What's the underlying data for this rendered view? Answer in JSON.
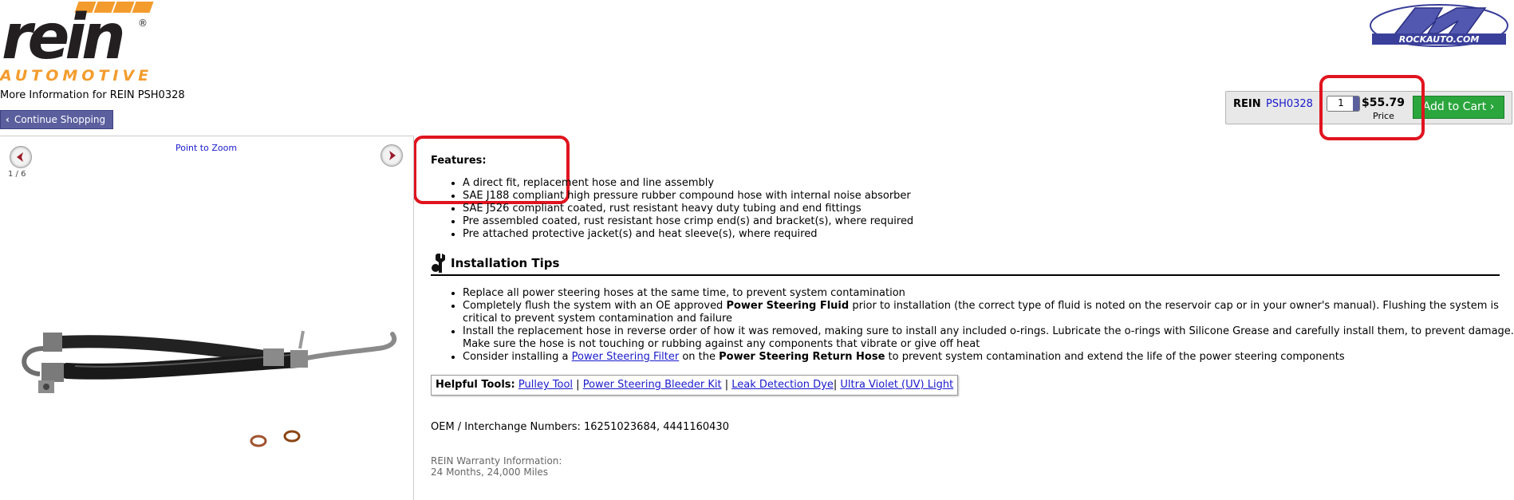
{
  "logo": {
    "wordmark": "rein",
    "registered": "®",
    "tagline": "AUTOMOTIVE"
  },
  "header": {
    "more_info": "More Information for REIN PSH0328",
    "continue_label": "Continue Shopping",
    "site_logo_text": "ROCKAUTO.COM"
  },
  "cart": {
    "brand": "REIN",
    "part_number": "PSH0328",
    "quantity": "1",
    "price": "$55.79",
    "price_label": "Price",
    "add_label": "Add to Cart"
  },
  "gallery": {
    "zoom_label": "Point to Zoom",
    "counter": "1 / 6"
  },
  "features": {
    "title": "Features:",
    "items": [
      "A direct fit, replacement hose and line assembly",
      "SAE J188 compliant high pressure rubber compound hose with internal noise absorber",
      "SAE J526 compliant coated, rust resistant heavy duty tubing and end fittings",
      "Pre assembled coated, rust resistant hose crimp end(s) and bracket(s), where required",
      "Pre attached protective jacket(s) and heat sleeve(s), where required"
    ]
  },
  "install": {
    "title": "Installation Tips",
    "tip1": "Replace all power steering hoses at the same time, to prevent system contamination",
    "tip2_a": "Completely flush the system with an OE approved ",
    "tip2_b": "Power Steering Fluid",
    "tip2_c": " prior to installation (the correct type of fluid is noted on the reservoir cap or in your owner's manual). Flushing the system is critical to prevent system contamination and failure",
    "tip3": "Install the replacement hose in reverse order of how it was removed, making sure to install any included o-rings. Lubricate the o-rings with Silicone Grease and carefully install them, to prevent damage. Make sure the hose is not touching or rubbing against any components that vibrate or give off heat",
    "tip4_a": "Consider installing a ",
    "tip4_link": "Power Steering Filter",
    "tip4_b": " on the ",
    "tip4_bold": "Power Steering Return Hose",
    "tip4_c": " to prevent system contamination and extend the life of the power steering components"
  },
  "helpful": {
    "label": "Helpful Tools:",
    "links": [
      "Pulley Tool",
      "Power Steering Bleeder Kit",
      "Leak Detection Dye",
      "Ultra Violet (UV) Light"
    ],
    "sep1": " | ",
    "sep2": " | ",
    "sep3": "| "
  },
  "oem": "OEM / Interchange Numbers: 16251023684, 4441160430",
  "warranty": {
    "title": "REIN Warranty Information:",
    "text": "24 Months, 24,000 Miles"
  },
  "colors": {
    "brand_orange": "#f39c2d",
    "button_purple": "#5b5f9e",
    "add_green": "#2aa63d",
    "highlight_red": "#e0141e",
    "link_blue": "#1a1acc"
  }
}
